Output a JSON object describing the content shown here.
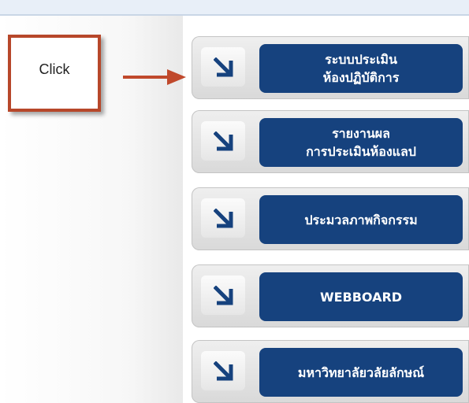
{
  "callout": {
    "text": "Click"
  },
  "colors": {
    "callout_border": "#b7472a",
    "arrow": "#c0492c",
    "panel": "#16427e",
    "icon": "#16427e"
  },
  "menu": {
    "items": [
      {
        "icon": "arrow-down-right-icon",
        "lines": [
          "ระบบประเมิน",
          "ห้องปฏิบัติการ"
        ]
      },
      {
        "icon": "arrow-down-right-icon",
        "lines": [
          "รายงานผล",
          "การประเมินห้องแลป"
        ]
      },
      {
        "icon": "arrow-down-right-icon",
        "lines": [
          "ประมวลภาพกิจกรรม"
        ]
      },
      {
        "icon": "arrow-down-right-icon",
        "lines": [
          "WEBBOARD"
        ]
      },
      {
        "icon": "arrow-down-right-icon",
        "lines": [
          "มหาวิทยาลัยวลัยลักษณ์"
        ]
      }
    ]
  }
}
